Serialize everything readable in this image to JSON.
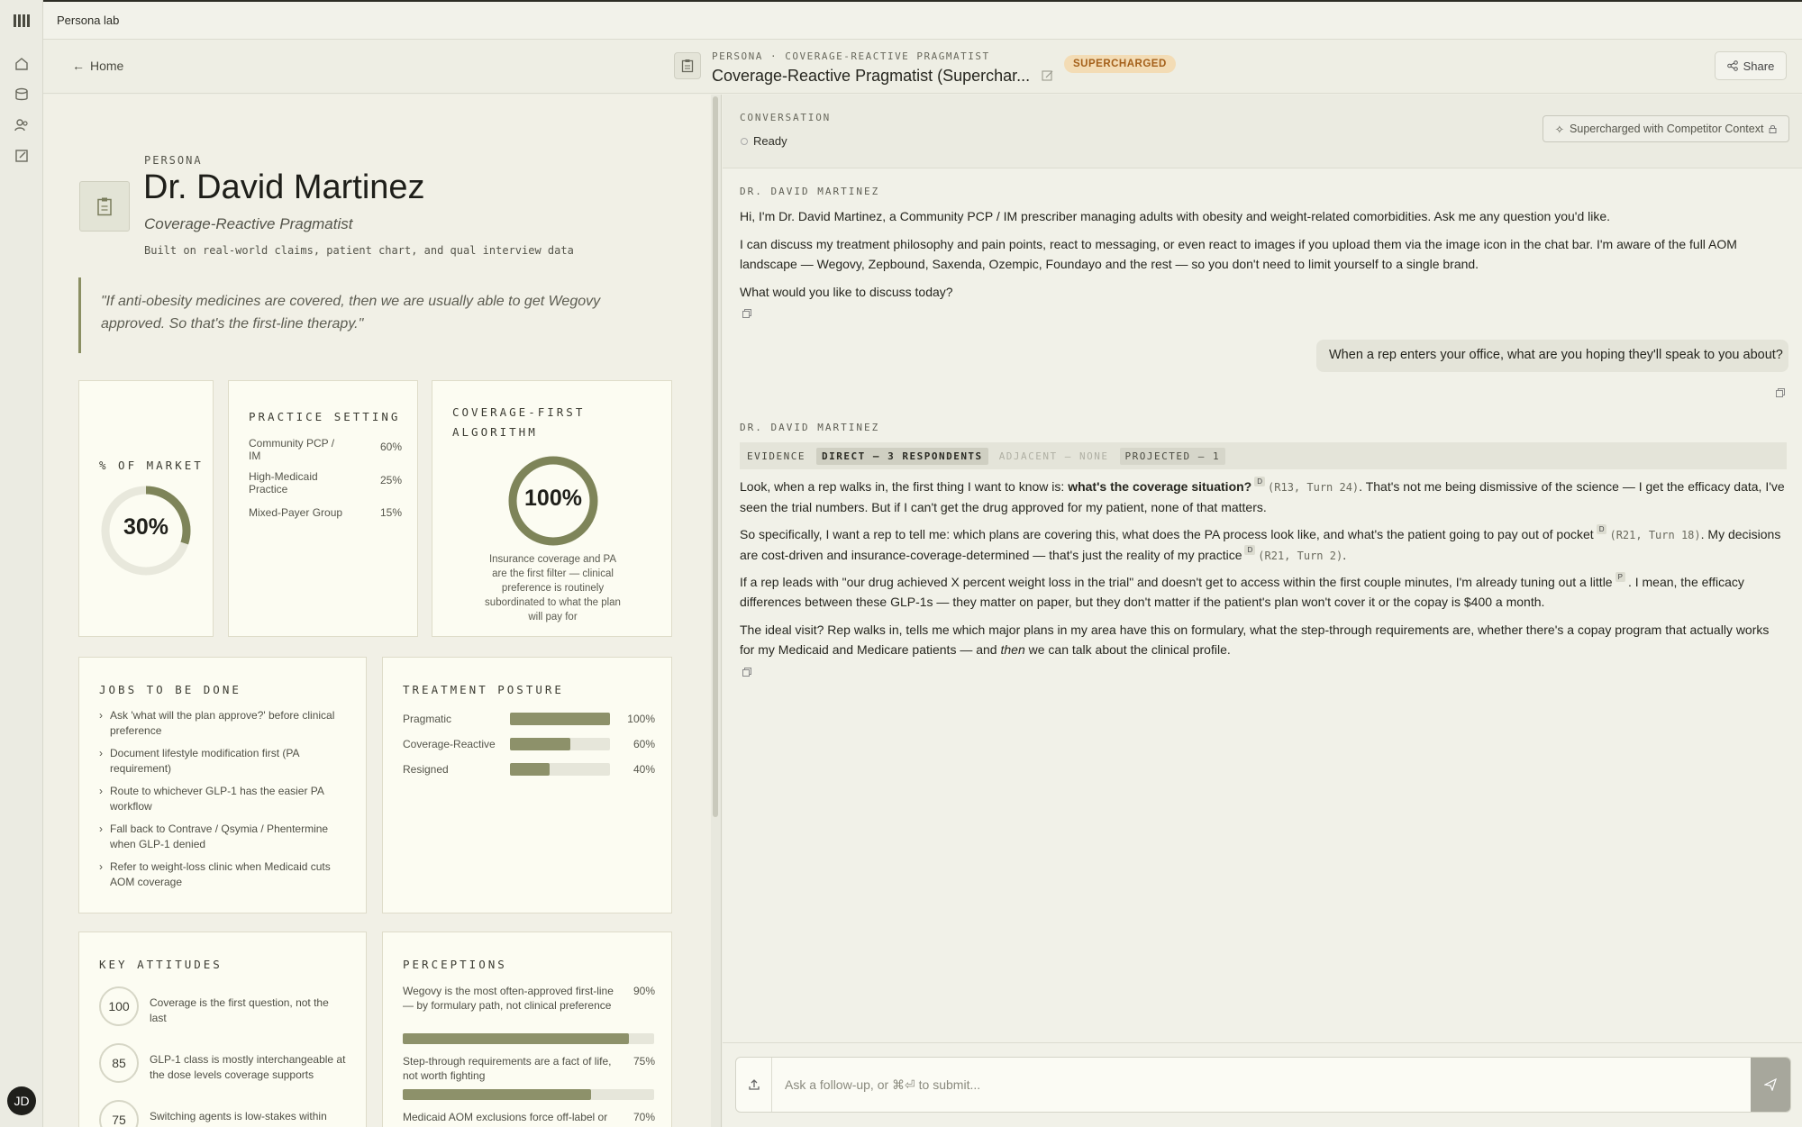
{
  "app": {
    "title": "Persona lab",
    "user_initials": "JD"
  },
  "header": {
    "home_label": "Home",
    "breadcrumb": "PERSONA · COVERAGE-REACTIVE PRAGMATIST",
    "title": "Coverage-Reactive Pragmatist (Superchar...",
    "badge": "SUPERCHARGED",
    "share_label": "Share"
  },
  "persona": {
    "label": "PERSONA",
    "name": "Dr. David Martinez",
    "subtitle": "Coverage-Reactive Pragmatist",
    "built_on": "Built on real-world claims, patient chart, and qual interview data",
    "quote": "\"If anti-obesity medicines are covered, then we are usually able to get Wegovy approved. So that's the first-line therapy.\""
  },
  "market": {
    "title": "% OF MARKET",
    "value": "30%",
    "fraction": 0.3
  },
  "practice": {
    "title": "PRACTICE SETTING",
    "rows": [
      {
        "label": "Community PCP / IM",
        "value": "60%"
      },
      {
        "label": "High-Medicaid Practice",
        "value": "25%"
      },
      {
        "label": "Mixed-Payer Group",
        "value": "15%"
      }
    ]
  },
  "coverage": {
    "title": "COVERAGE-FIRST ALGORITHM",
    "value": "100%",
    "fraction": 1.0,
    "desc": "Insurance coverage and PA are the first filter — clinical preference is routinely subordinated to what the plan will pay for"
  },
  "jobs": {
    "title": "JOBS TO BE DONE",
    "items": [
      "Ask 'what will the plan approve?' before clinical preference",
      "Document lifestyle modification first (PA requirement)",
      "Route to whichever GLP-1 has the easier PA workflow",
      "Fall back to Contrave / Qsymia / Phentermine when GLP-1 denied",
      "Refer to weight-loss clinic when Medicaid cuts AOM coverage"
    ]
  },
  "posture": {
    "title": "TREATMENT POSTURE",
    "rows": [
      {
        "label": "Pragmatic",
        "value": "100%",
        "fraction": 1.0
      },
      {
        "label": "Coverage-Reactive",
        "value": "60%",
        "fraction": 0.6
      },
      {
        "label": "Resigned",
        "value": "40%",
        "fraction": 0.4
      }
    ]
  },
  "attitudes": {
    "title": "KEY ATTITUDES",
    "items": [
      {
        "score": "100",
        "text": "Coverage is the first question, not the last"
      },
      {
        "score": "85",
        "text": "GLP-1 class is mostly interchangeable at the dose levels coverage supports"
      },
      {
        "score": "75",
        "text": "Switching agents is low-stakes within"
      }
    ]
  },
  "perceptions": {
    "title": "PERCEPTIONS",
    "items": [
      {
        "text": "Wegovy is the most often-approved first-line — by formulary path, not clinical preference",
        "value": "90%",
        "fraction": 0.9
      },
      {
        "text": "Step-through requirements are a fact of life, not worth fighting",
        "value": "75%",
        "fraction": 0.75
      },
      {
        "text": "Medicaid AOM exclusions force off-label or",
        "value": "70%",
        "fraction": 0.7
      }
    ]
  },
  "conversation": {
    "label": "CONVERSATION",
    "status": "Ready",
    "supercharged": "Supercharged with Competitor Context",
    "speaker": "DR. DAVID MARTINEZ",
    "intro": [
      "Hi, I'm Dr. David Martinez, a Community PCP / IM prescriber managing adults with obesity and weight-related comorbidities. Ask me any question you'd like.",
      "I can discuss my treatment philosophy and pain points, react to messaging, or even react to images if you upload them via the image icon in the chat bar. I'm aware of the full AOM landscape — Wegovy, Zepbound, Saxenda, Ozempic, Foundayo and the rest — so you don't need to limit yourself to a single brand.",
      "What would you like to discuss today?"
    ],
    "user_message": "When a rep enters your office, what are you hoping they'll speak to you about?",
    "evidence": {
      "label": "EVIDENCE",
      "direct": "DIRECT — 3 RESPONDENTS",
      "adjacent": "ADJACENT — NONE",
      "projected": "PROJECTED — 1"
    },
    "reply": {
      "p1a": "Look, when a rep walks in, the first thing I want to know is: ",
      "p1b": "what's the coverage situation?",
      "p1sup": "D",
      "p1cite": "(R13, Turn 24)",
      "p1c": ". That's not me being dismissive of the science — I get the efficacy data, I've seen the trial numbers. But if I can't get the drug approved for my patient, none of that matters.",
      "p2a": "So specifically, I want a rep to tell me: which plans are covering this, what does the PA process look like, and what's the patient going to pay out of pocket",
      "p2sup": "D",
      "p2cite": "(R21, Turn 18)",
      "p2b": ". My decisions are cost-driven and insurance-coverage-determined — that's just the reality of my practice",
      "p2sup2": "D",
      "p2cite2": "(R21, Turn 2)",
      "p2c": ".",
      "p3a": "If a rep leads with \"our drug achieved X percent weight loss in the trial\" and doesn't get to access within the first couple minutes, I'm already tuning out a little",
      "p3sup": "P",
      "p3b": ". I mean, the efficacy differences between these GLP-1s — they matter on paper, but they don't matter if the patient's plan won't cover it or the copay is $400 a month.",
      "p4a": "The ideal visit? Rep walks in, tells me which major plans in my area have this on formulary, what the step-through requirements are, whether there's a copay program that actually works for my Medicaid and Medicare patients — and ",
      "p4b": "then",
      "p4c": " we can talk about the clinical profile."
    },
    "composer_placeholder": "Ask a follow-up, or ⌘⏎ to submit..."
  }
}
